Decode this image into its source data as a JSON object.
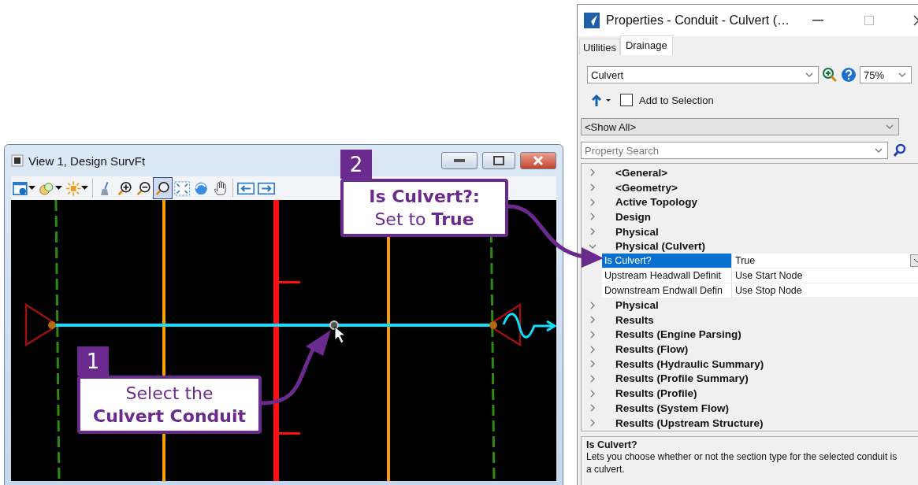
{
  "view_window": {
    "title": "View 1, Design SurvFt",
    "tools": [
      {
        "kind": "view",
        "selected": false
      },
      {
        "kind": "display",
        "selected": false
      },
      {
        "kind": "light",
        "selected": false
      },
      {
        "kind": "brush",
        "selected": false
      },
      {
        "kind": "zoomin",
        "selected": false
      },
      {
        "kind": "zoomout",
        "selected": false
      },
      {
        "kind": "window",
        "selected": true
      },
      {
        "kind": "fit",
        "selected": false
      },
      {
        "kind": "rotate",
        "selected": false
      },
      {
        "kind": "pan",
        "selected": false
      },
      {
        "kind": "previous",
        "selected": false
      },
      {
        "kind": "next",
        "selected": false
      }
    ]
  },
  "callouts": [
    {
      "number": "2",
      "lines": [
        "**Is Culvert?:**",
        "Set to **True**"
      ]
    },
    {
      "number": "1",
      "lines": [
        "Select the",
        "**Culvert Conduit**"
      ]
    }
  ],
  "properties": {
    "title": "Properties - Conduit - Culvert (…",
    "tabs": [
      {
        "label": "Utilities",
        "selected": false
      },
      {
        "label": "Drainage",
        "selected": true
      }
    ],
    "element_combo": "Culvert",
    "zoom_combo": "75%",
    "add_to_selection": {
      "label": "Add to Selection",
      "checked": false
    },
    "filter": "<Show All>",
    "search": {
      "placeholder": "Property Search"
    },
    "tree": [
      {
        "label": "<General>",
        "expanded": false
      },
      {
        "label": "<Geometry>",
        "expanded": false
      },
      {
        "label": "Active Topology",
        "expanded": false
      },
      {
        "label": "Design",
        "expanded": false
      },
      {
        "label": "Physical",
        "expanded": false
      },
      {
        "label": "Physical (Culvert)",
        "expanded": true,
        "children": [
          {
            "name": "Is Culvert?",
            "value": "True",
            "selected": true
          },
          {
            "name": "Upstream Headwall Definit",
            "value": "Use Start Node",
            "selected": false
          },
          {
            "name": "Downstream Endwall Defin",
            "value": "Use Stop Node",
            "selected": false
          }
        ]
      },
      {
        "label": "Physical",
        "expanded": false
      },
      {
        "label": "Results",
        "expanded": false
      },
      {
        "label": "Results (Engine Parsing)",
        "expanded": false
      },
      {
        "label": "Results (Flow)",
        "expanded": false
      },
      {
        "label": "Results (Hydraulic Summary)",
        "expanded": false
      },
      {
        "label": "Results (Profile Summary)",
        "expanded": false
      },
      {
        "label": "Results (Profile)",
        "expanded": false
      },
      {
        "label": "Results (System Flow)",
        "expanded": false
      },
      {
        "label": "Results (Upstream Structure)",
        "expanded": false
      }
    ],
    "description": {
      "title": "Is Culvert?",
      "text": "Lets you choose whether or not the section type for the selected conduit is a culvert."
    }
  }
}
